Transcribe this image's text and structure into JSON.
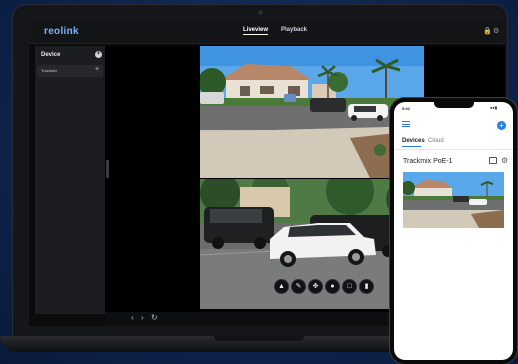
{
  "desktop": {
    "logo": "reolink",
    "tabs": [
      {
        "label": "Liveview",
        "active": true
      },
      {
        "label": "Playback",
        "active": false
      }
    ],
    "top_icons": [
      "lock-icon",
      "gear-icon"
    ],
    "sidebar": {
      "header": "Device",
      "items": [
        {
          "label": "Trackmix"
        }
      ]
    },
    "controls": [
      "siren-icon",
      "pen-icon",
      "ptz-icon",
      "mic-icon",
      "snapshot-icon",
      "record-icon"
    ],
    "bottom_nav": [
      "chevron-left-icon",
      "chevron-right-icon",
      "refresh-icon"
    ]
  },
  "phone": {
    "time": "9:41",
    "tabs": [
      {
        "label": "Devices",
        "active": true
      },
      {
        "label": "Cloud",
        "active": false
      }
    ],
    "device_name": "Trackmix PoE-1"
  },
  "colors": {
    "accent": "#2a7de1",
    "logo": "#7ab4ff",
    "background": "#0f2550"
  }
}
